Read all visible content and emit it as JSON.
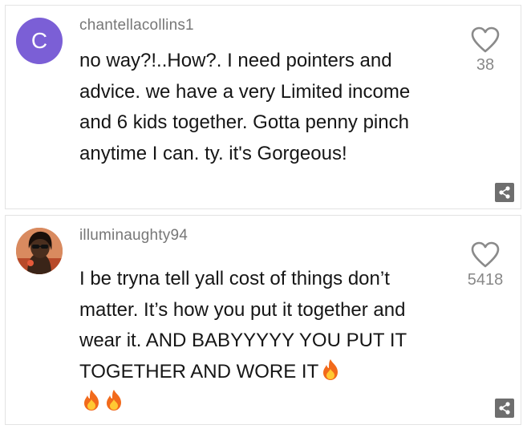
{
  "comments": [
    {
      "username": "chantellacollins1",
      "avatar_initial": "C",
      "avatar_color": "#7b5fd6",
      "text": "no way?!..How?. I need pointers and advice. we have a very Limited income and 6 kids together. Gotta penny pinch anytime I can. ty. it's Gorgeous!",
      "likes": "38"
    },
    {
      "username": "illuminaughty94",
      "avatar_type": "photo",
      "text": "I be tryna tell yall cost of things don’t matter. It’s how you put it together and wear it. AND BABYYYYY YOU PUT IT TOGETHER AND WORE IT",
      "emoji_icon": "fire-icon",
      "emoji_count": 3,
      "likes": "5418"
    }
  ],
  "colors": {
    "username": "#777777",
    "text": "#161616",
    "like_count": "#888888",
    "share_bg": "#6e6e6e",
    "border": "#e3e3e3"
  }
}
